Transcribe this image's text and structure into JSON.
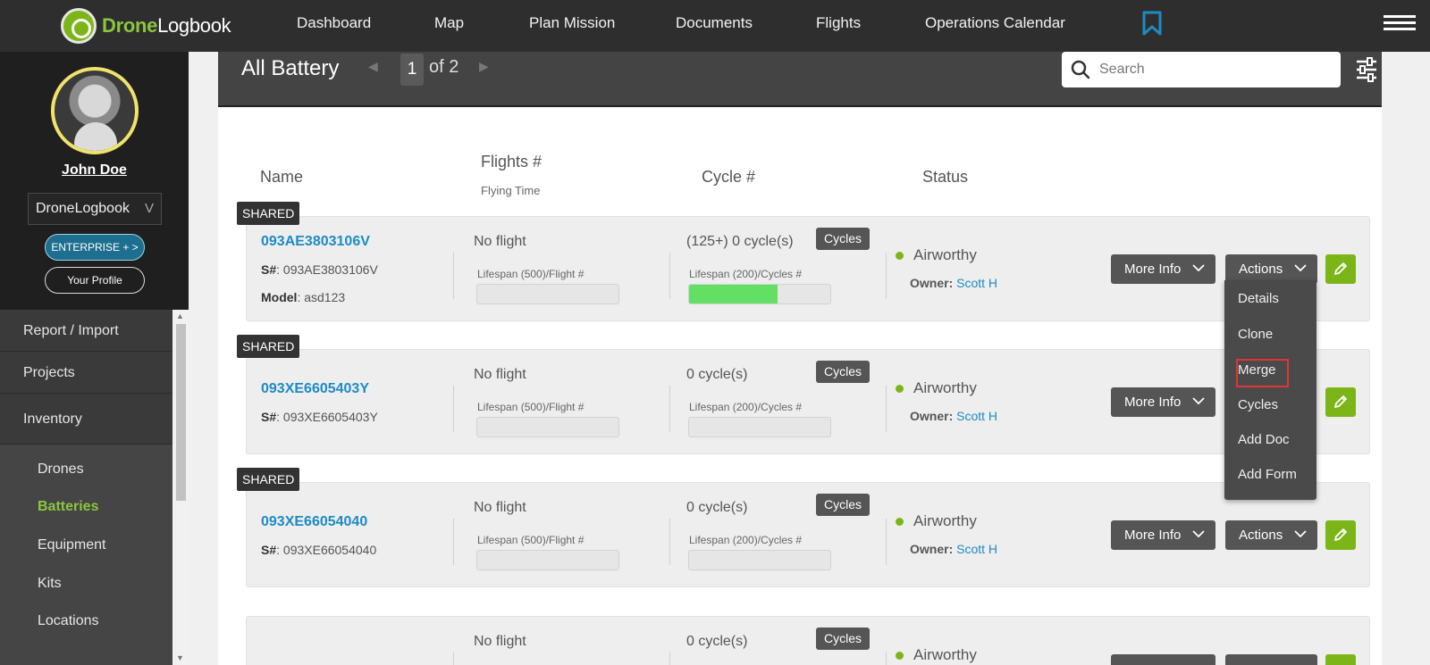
{
  "brand": {
    "accent": "Drone",
    "rest": "Logbook"
  },
  "nav": {
    "dashboard": "Dashboard",
    "map": "Map",
    "plan_mission": "Plan Mission",
    "documents": "Documents",
    "flights": "Flights",
    "calendar": "Operations Calendar"
  },
  "user": {
    "name": "John Doe",
    "org": "DroneLogbook",
    "org_chevron": "V"
  },
  "buttons": {
    "enterprise": "ENTERPRISE + >",
    "profile": "Your Profile"
  },
  "menu": {
    "report": "Report / Import",
    "projects": "Projects",
    "inventory": "Inventory",
    "sub": [
      "Drones",
      "Batteries",
      "Equipment",
      "Kits",
      "Locations"
    ]
  },
  "header": {
    "title": "All Battery",
    "page_current": "1",
    "page_of": "of 2",
    "search_placeholder": "Search"
  },
  "columns": {
    "name": "Name",
    "flights": "Flights #",
    "flying_time": "Flying Time",
    "cycle": "Cycle #",
    "status": "Status"
  },
  "labels": {
    "shared": "SHARED",
    "serial_prefix": "S#",
    "model_prefix": "Model",
    "no_flight": "No flight",
    "lifespan_flight": "Lifespan (500)/Flight #",
    "lifespan_cycles": "Lifespan (200)/Cycles #",
    "cycles_btn": "Cycles",
    "owner_prefix": "Owner:",
    "more_info": "More Info",
    "actions": "Actions"
  },
  "rows": [
    {
      "name": "093AE3803106V",
      "serial": ": 093AE3803106V",
      "model": ": asd123",
      "cycles": "(125+) 0 cycle(s)",
      "cycle_fill": 0.625,
      "status": "Airworthy",
      "owner": "Scott H"
    },
    {
      "name": "093XE6605403Y",
      "serial": ": 093XE6605403Y",
      "cycles": "0 cycle(s)",
      "cycle_fill": 0,
      "status": "Airworthy",
      "owner": "Scott H"
    },
    {
      "name": "093XE66054040",
      "serial": ": 093XE66054040",
      "cycles": "0 cycle(s)",
      "cycle_fill": 0,
      "status": "Airworthy",
      "owner": "Scott H"
    },
    {
      "cycles": "0 cycle(s)",
      "status": "Airworthy"
    }
  ],
  "actions_menu": [
    "Details",
    "Clone",
    "Merge",
    "Cycles",
    "Add Doc",
    "Add Form"
  ],
  "colors": {
    "topnav": "#2e2e2e",
    "brand_green": "#8cc63f",
    "link_blue": "#1e8bc3",
    "highlight_red": "#e03535"
  },
  "icons": [
    "bookmark-icon",
    "hamburger-icon",
    "search-icon",
    "filter-icon",
    "chevron-down-icon",
    "pencil-icon"
  ]
}
